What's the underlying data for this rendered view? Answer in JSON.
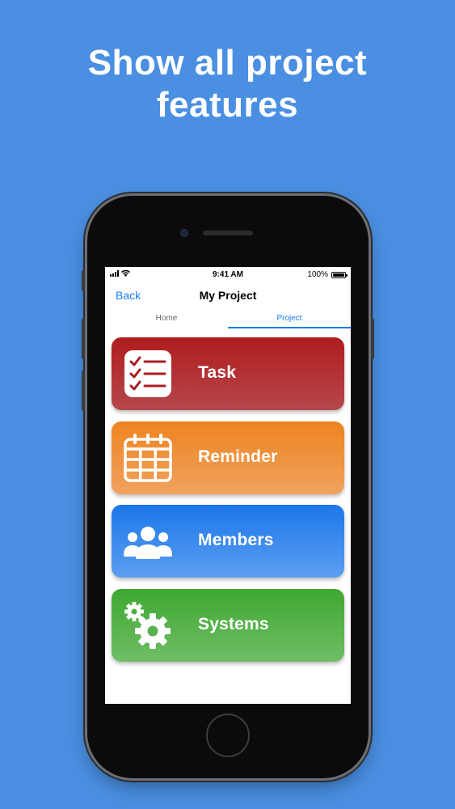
{
  "headline": "Show all project\nfeatures",
  "status_bar": {
    "time": "9:41 AM",
    "battery": "100%"
  },
  "nav": {
    "back_label": "Back",
    "title": "My Project"
  },
  "tabs": [
    {
      "label": "Home",
      "active": false
    },
    {
      "label": "Project",
      "active": true
    }
  ],
  "features": [
    {
      "label": "Task",
      "icon": "checklist-icon",
      "color": "#b01d1d"
    },
    {
      "label": "Reminder",
      "icon": "calendar-icon",
      "color": "#ee8420"
    },
    {
      "label": "Members",
      "icon": "group-icon",
      "color": "#1c77ea"
    },
    {
      "label": "Systems",
      "icon": "gears-icon",
      "color": "#3ea830"
    }
  ],
  "colors": {
    "background": "#4a8fe2",
    "accent": "#1a7bf0"
  }
}
